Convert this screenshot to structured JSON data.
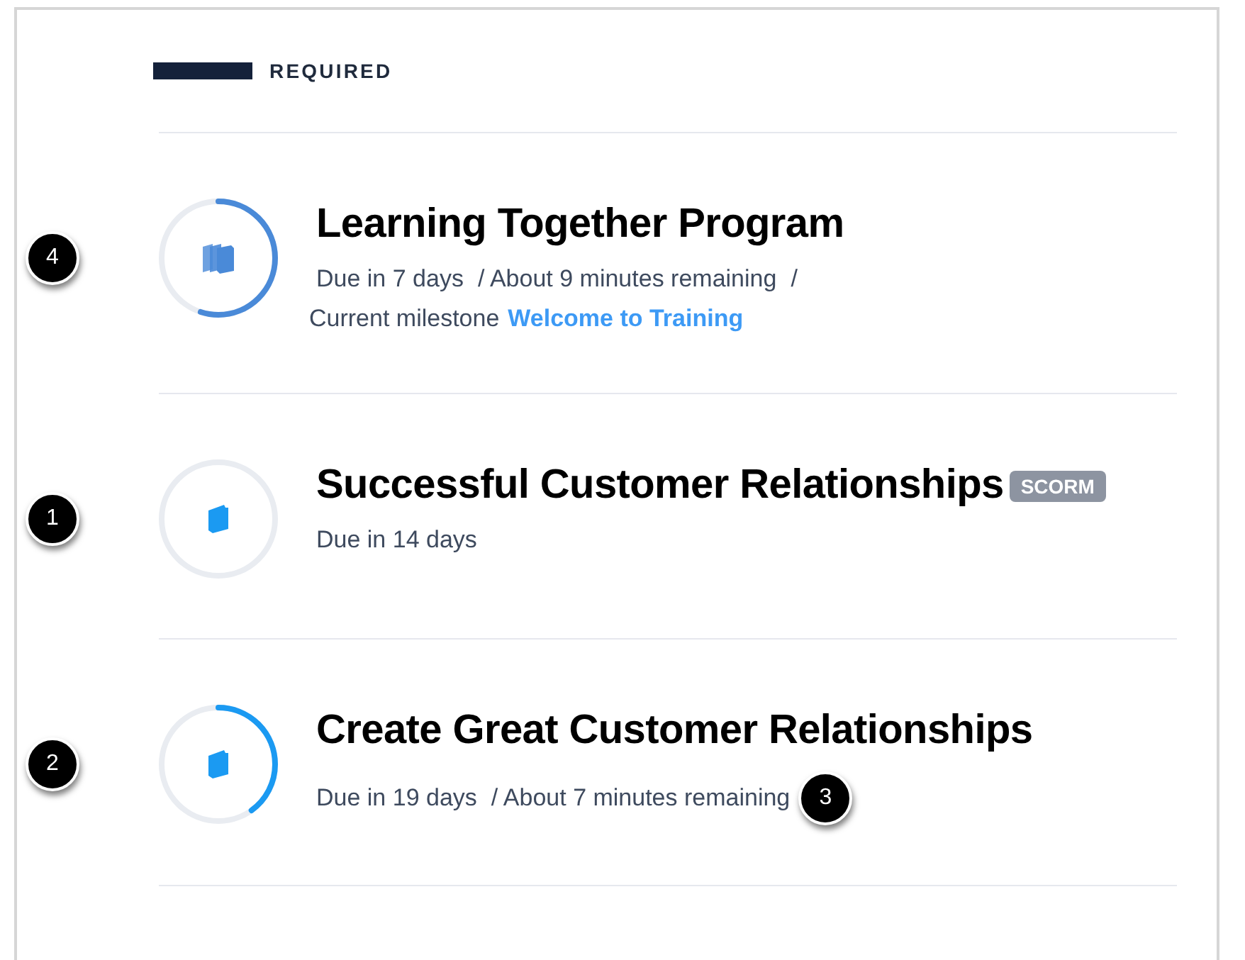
{
  "section": {
    "label": "REQUIRED"
  },
  "items": [
    {
      "kind": "program",
      "title": "Learning Together Program",
      "level": 0.55,
      "callout": "4",
      "meta": [
        "Due in 7 days",
        "/ About 9 minutes remaining",
        "/"
      ],
      "milestone": {
        "label": "Current milestone",
        "link": "Welcome to Training"
      }
    },
    {
      "kind": "course",
      "title": "Successful Customer Relationships",
      "badge": "SCORM",
      "level": 0,
      "callout": "1",
      "meta": [
        "Due in 14 days"
      ]
    },
    {
      "kind": "course",
      "title": "Create Great Customer Relationships",
      "level": 0.4,
      "callout": "2",
      "meta": [
        "Due in 19 days",
        "/ About 7 minutes remaining"
      ],
      "meta_callout": "3"
    }
  ]
}
